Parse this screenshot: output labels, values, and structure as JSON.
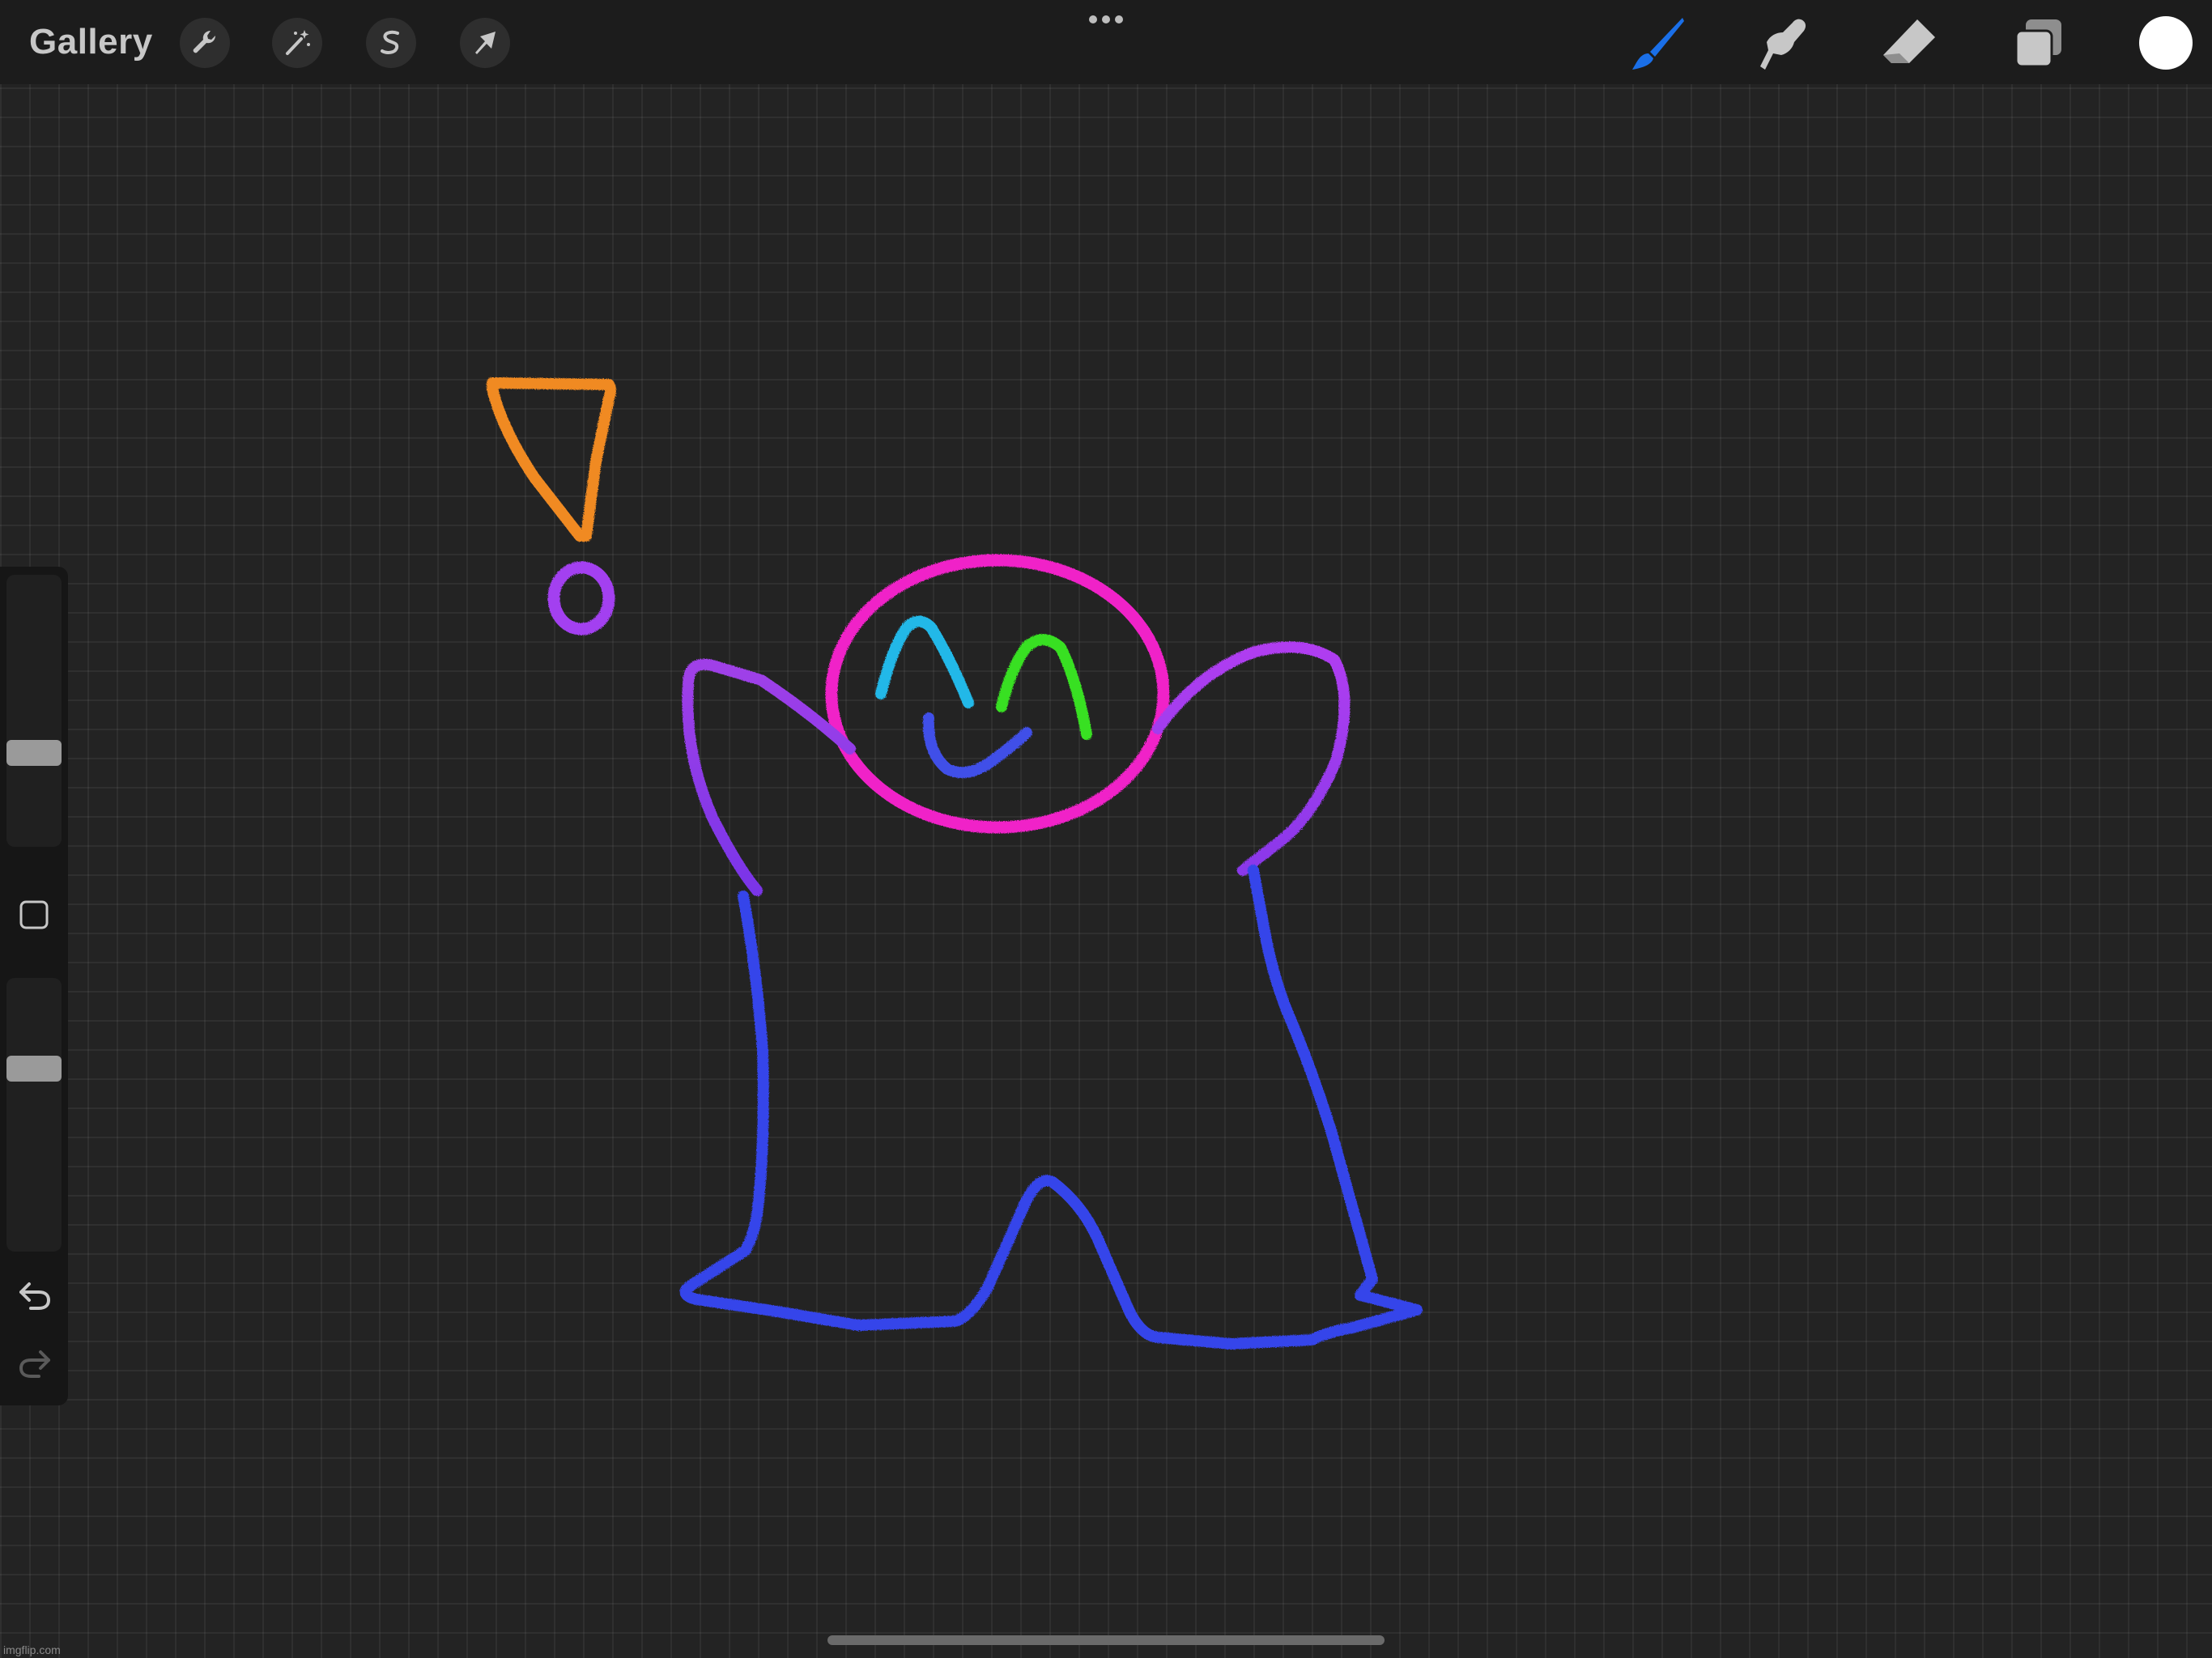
{
  "topbar": {
    "gallery_label": "Gallery",
    "left_tools": [
      {
        "name": "actions",
        "icon": "wrench-icon"
      },
      {
        "name": "adjustments",
        "icon": "magic-wand-icon"
      },
      {
        "name": "selection",
        "icon": "selection-s-icon"
      },
      {
        "name": "transform",
        "icon": "arrow-cursor-icon"
      }
    ],
    "more_icon": "more-dots-icon",
    "right_tools": [
      {
        "name": "brush",
        "icon": "brush-icon",
        "active": true
      },
      {
        "name": "smudge",
        "icon": "smudge-icon",
        "active": false
      },
      {
        "name": "eraser",
        "icon": "eraser-icon",
        "active": false
      },
      {
        "name": "layers",
        "icon": "layers-icon",
        "active": false
      }
    ],
    "current_color": "#ffffff"
  },
  "sidebar": {
    "brush_size_slider": {
      "icon": "size-slider"
    },
    "modify_button_icon": "square-icon",
    "opacity_slider": {
      "icon": "opacity-slider"
    },
    "undo_icon": "undo-icon",
    "redo_icon": "redo-icon"
  },
  "colors": {
    "accent_blue": "#1a6fe8",
    "stroke_orange": "#f08a24",
    "stroke_purple": "#a33ff0",
    "stroke_magenta": "#f020c8",
    "stroke_cyan": "#20b8e8",
    "stroke_green": "#38e020",
    "stroke_blue": "#3545ea"
  },
  "watermark": "imgflip.com"
}
